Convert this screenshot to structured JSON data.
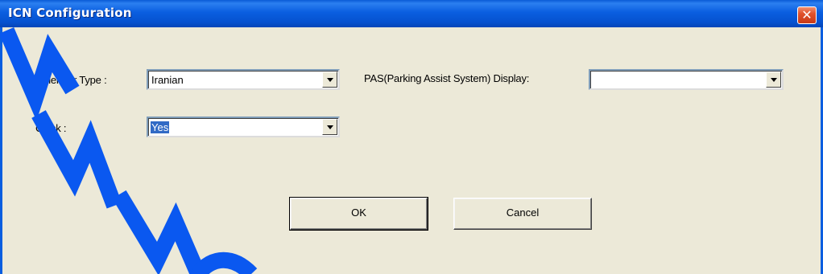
{
  "window": {
    "title": "ICN Configuration",
    "close_glyph": "✕",
    "close_icon": "close-icon",
    "titlebar_color": "#0a5ee0"
  },
  "form": {
    "calendar_type": {
      "label": "Calender Type :",
      "value": "Iranian"
    },
    "clock": {
      "label": "Clock :",
      "value": "Yes",
      "selection_color": "#316ac5"
    },
    "pas_display": {
      "label": "PAS(Parking Assist System) Display:",
      "value": ""
    }
  },
  "buttons": {
    "ok_label": "OK",
    "cancel_label": "Cancel"
  },
  "watermark": {
    "color": "#0a58f0"
  }
}
